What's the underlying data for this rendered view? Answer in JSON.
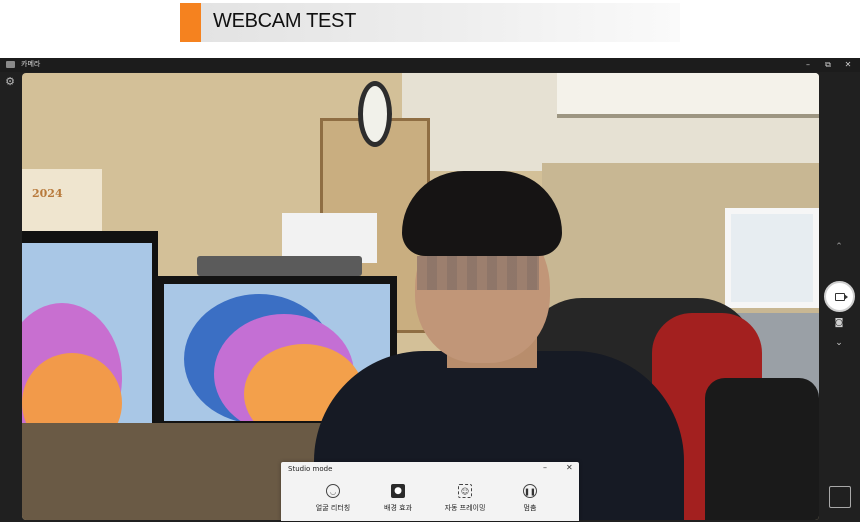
{
  "banner": {
    "title": "WEBCAM TEST",
    "accent_color": "#f5821f"
  },
  "window": {
    "app_title": "카메라",
    "controls": {
      "minimize": "–",
      "maximize": "⧉",
      "close": "✕"
    }
  },
  "camera_controls": {
    "settings_icon": "gear-icon",
    "mode_up_icon": "chevron-up-icon",
    "record_icon": "video-camera-icon",
    "photo_icon": "camera-icon",
    "mode_down_icon": "chevron-down-icon"
  },
  "studio_mode": {
    "title": "Studio mode",
    "minimize": "–",
    "close": "✕",
    "effects": [
      {
        "label": "얼굴 리터칭",
        "icon": "face-retouch-icon"
      },
      {
        "label": "배경 효과",
        "icon": "background-effect-icon"
      },
      {
        "label": "자동 프레이밍",
        "icon": "auto-framing-icon"
      },
      {
        "label": "멈춤",
        "icon": "pause-icon"
      }
    ]
  },
  "scene": {
    "calendar_text": "2024"
  }
}
